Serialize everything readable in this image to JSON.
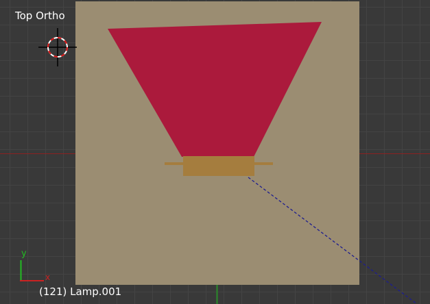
{
  "viewport": {
    "view_label": "Top Ortho",
    "object_info": "(121) Lamp.001",
    "axis_gizmo": {
      "x_label": "x",
      "y_label": "y",
      "x_color": "#cc2222",
      "y_color": "#22bb22"
    },
    "cursor_icon": "3d-cursor-icon",
    "colors": {
      "background": "#393939",
      "grid": "#444444",
      "floor_plane": "#9b8d72",
      "lampshade": "#ab1a3c",
      "lamp_base": "#a57d3e",
      "x_axis_line": "#8c2020",
      "y_axis_line": "#2a8a2a",
      "lamp_direction_line": "#1d1d8f"
    }
  }
}
